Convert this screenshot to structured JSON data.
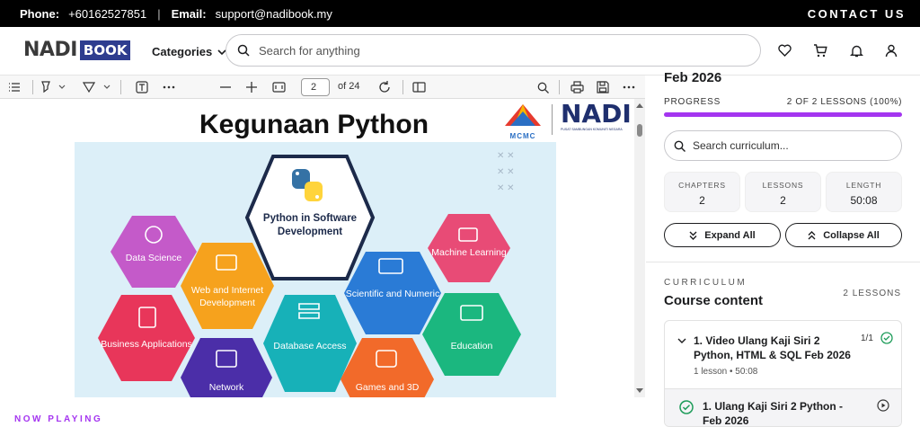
{
  "topbar": {
    "phone_label": "Phone:",
    "phone_value": "+60162527851",
    "separator": "|",
    "email_label": "Email:",
    "email_value": "support@nadibook.my",
    "contact_label": "CONTACT US"
  },
  "nav": {
    "logo_text": "NADI",
    "logo_box_text": "BOOK",
    "categories_label": "Categories",
    "search_placeholder": "Search for anything",
    "icons": [
      "heart-icon",
      "cart-icon",
      "bell-icon",
      "user-icon"
    ]
  },
  "viewer": {
    "page_number": "2",
    "page_total": "of 24",
    "slide_title": "Kegunaan Python",
    "logo_mcmc": "MCMC",
    "logo_nadi": "NADI",
    "logo_nadi_sub": "PUSAT SAMBUNGAN KOMUNITI NEGARA",
    "hexes": [
      {
        "label": "Python in Software Development"
      },
      {
        "label": "Data Science"
      },
      {
        "label": "Web and Internet Development"
      },
      {
        "label": "Scientific and Numeric"
      },
      {
        "label": "Machine Learning"
      },
      {
        "label": "Business Applications"
      },
      {
        "label": "Database Access"
      },
      {
        "label": "Education"
      },
      {
        "label": "Network"
      },
      {
        "label": "Games and 3D"
      }
    ]
  },
  "now_playing": "NOW PLAYING",
  "panel": {
    "course_title": "Feb 2026",
    "progress_label": "PROGRESS",
    "progress_value": "2 OF 2 LESSONS (100%)",
    "progress_fraction": 1.0,
    "search_placeholder": "Search curriculum...",
    "stats": [
      {
        "label": "CHAPTERS",
        "value": "2"
      },
      {
        "label": "LESSONS",
        "value": "2"
      },
      {
        "label": "LENGTH",
        "value": "50:08"
      }
    ],
    "expand_label": "Expand All",
    "collapse_label": "Collapse All",
    "curriculum_label": "CURRICULUM",
    "course_content_label": "Course content",
    "lessons_count": "2 LESSONS",
    "chapter": {
      "title": "1. Video Ulang Kaji Siri 2 Python, HTML & SQL Feb 2026",
      "count": "1/1",
      "meta": "1 lesson • 50:08"
    },
    "lesson": {
      "title": "1. Ulang Kaji Siri 2 Python - Feb 2026"
    }
  },
  "colors": {
    "accent": "#a435f0",
    "check": "#1e9c5a",
    "brand": "#2e3d8f"
  }
}
